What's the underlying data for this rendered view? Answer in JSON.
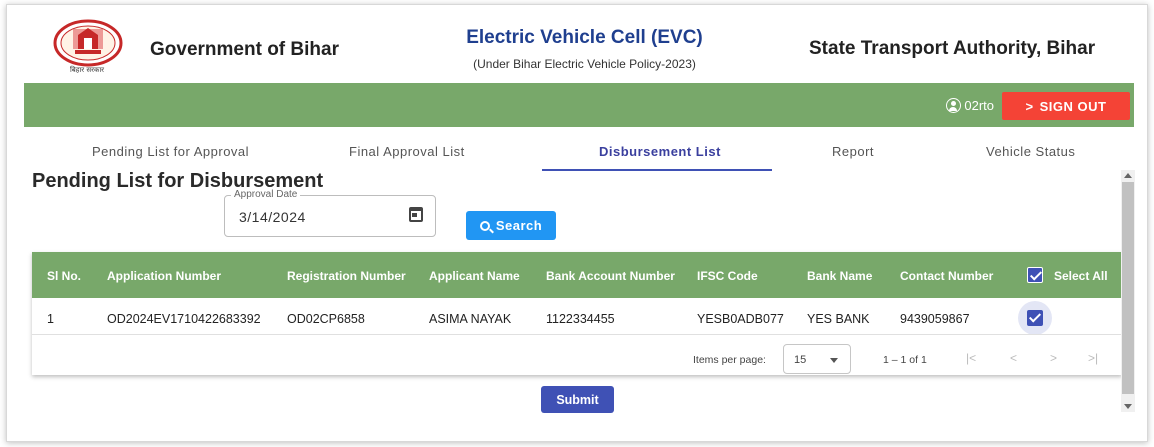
{
  "header": {
    "emblem_caption": "बिहार सरकार",
    "gov_title": "Government of Bihar",
    "evc_title": "Electric Vehicle Cell (EVC)",
    "evc_subtitle": "(Under Bihar Electric Vehicle Policy-2023)",
    "authority_title": "State Transport Authority, Bihar"
  },
  "topbar": {
    "username": "02rto",
    "signout_label": "SIGN OUT",
    "user_icon": "account-circle-icon"
  },
  "tabs": [
    {
      "label": "Pending List for Approval",
      "active": false
    },
    {
      "label": "Final Approval List",
      "active": false
    },
    {
      "label": "Disbursement List",
      "active": true
    },
    {
      "label": "Report",
      "active": false
    },
    {
      "label": "Vehicle Status",
      "active": false
    }
  ],
  "page_title": "Pending List for Disbursement",
  "filter": {
    "approval_date_label": "Approval Date",
    "approval_date_value": "3/14/2024",
    "search_label": "Search"
  },
  "table": {
    "columns": [
      "Sl No.",
      "Application Number",
      "Registration Number",
      "Applicant Name",
      "Bank Account Number",
      "IFSC Code",
      "Bank Name",
      "Contact Number",
      "Select All"
    ],
    "rows": [
      {
        "sl_no": "1",
        "application_number": "OD2024EV1710422683392",
        "registration_number": "OD02CP6858",
        "applicant_name": "ASIMA NAYAK",
        "bank_account_number": "1122334455",
        "ifsc_code": "YESB0ADB077",
        "bank_name": "YES BANK",
        "contact_number": "9439059867",
        "selected": true
      }
    ],
    "select_all_checked": true
  },
  "paginator": {
    "items_per_page_label": "Items per page:",
    "items_per_page_value": "15",
    "range_label": "1 – 1 of 1"
  },
  "submit_label": "Submit",
  "colors": {
    "green_bar": "#78a86a",
    "primary": "#3f51b5",
    "search_blue": "#2196f3",
    "signout_red": "#f44336",
    "title_blue": "#1f3f8f"
  }
}
